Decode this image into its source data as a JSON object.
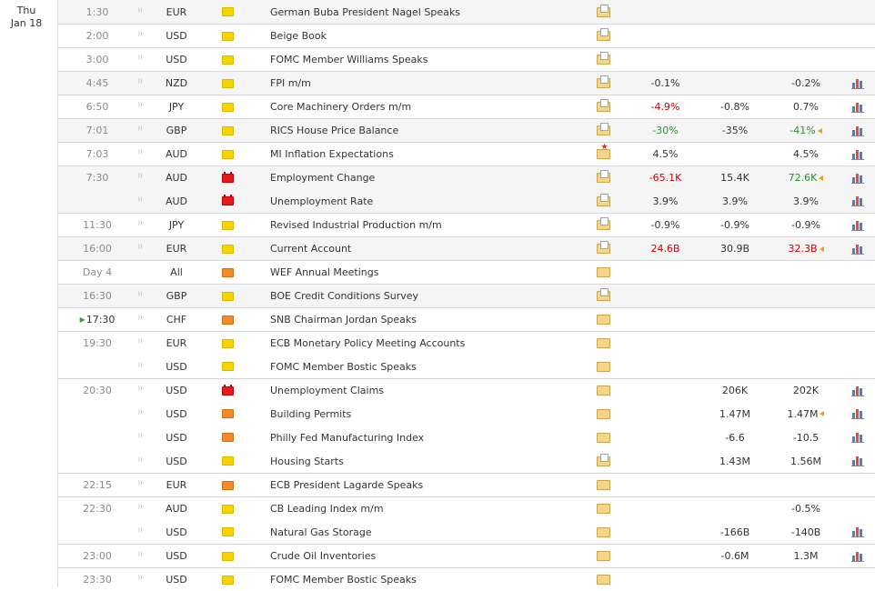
{
  "date": {
    "weekday": "Thu",
    "day": "Jan 18"
  },
  "colors": {
    "negative": "#cc0000",
    "positive": "#2d8e2d",
    "low": "#f6d400",
    "medium": "#f08a2a",
    "high": "#e31d1d"
  },
  "rows": [
    {
      "time": "1:30",
      "cur": "EUR",
      "imp": "low",
      "event": "German Buba President Nagel Speaks",
      "doc": "doc",
      "actual": "",
      "actual_color": "",
      "forecast": "",
      "previous": "",
      "previous_color": "",
      "revised": false,
      "chart": false,
      "alt": true,
      "sep": false
    },
    {
      "time": "2:00",
      "cur": "USD",
      "imp": "low",
      "event": "Beige Book",
      "doc": "doc",
      "actual": "",
      "actual_color": "",
      "forecast": "",
      "previous": "",
      "previous_color": "",
      "revised": false,
      "chart": false,
      "alt": false,
      "sep": true
    },
    {
      "time": "3:00",
      "cur": "USD",
      "imp": "low",
      "event": "FOMC Member Williams Speaks",
      "doc": "doc",
      "actual": "",
      "actual_color": "",
      "forecast": "",
      "previous": "",
      "previous_color": "",
      "revised": false,
      "chart": false,
      "alt": false,
      "sep": true
    },
    {
      "time": "4:45",
      "cur": "NZD",
      "imp": "low",
      "event": "FPI m/m",
      "doc": "doc",
      "actual": "-0.1%",
      "actual_color": "",
      "forecast": "",
      "previous": "-0.2%",
      "previous_color": "",
      "revised": false,
      "chart": true,
      "alt": true,
      "sep": true
    },
    {
      "time": "6:50",
      "cur": "JPY",
      "imp": "low",
      "event": "Core Machinery Orders m/m",
      "doc": "doc",
      "actual": "-4.9%",
      "actual_color": "red",
      "forecast": "-0.8%",
      "previous": "0.7%",
      "previous_color": "",
      "revised": false,
      "chart": true,
      "alt": false,
      "sep": true
    },
    {
      "time": "7:01",
      "cur": "GBP",
      "imp": "low",
      "event": "RICS House Price Balance",
      "doc": "doc",
      "actual": "-30%",
      "actual_color": "green",
      "forecast": "-35%",
      "previous": "-41%",
      "previous_color": "green",
      "revised": true,
      "chart": true,
      "alt": true,
      "sep": true
    },
    {
      "time": "7:03",
      "cur": "AUD",
      "imp": "low",
      "event": "MI Inflation Expectations",
      "doc": "star",
      "actual": "4.5%",
      "actual_color": "",
      "forecast": "",
      "previous": "4.5%",
      "previous_color": "",
      "revised": false,
      "chart": true,
      "alt": false,
      "sep": true
    },
    {
      "time": "7:30",
      "cur": "AUD",
      "imp": "high",
      "event": "Employment Change",
      "doc": "doc",
      "actual": "-65.1K",
      "actual_color": "red",
      "forecast": "15.4K",
      "previous": "72.6K",
      "previous_color": "green",
      "revised": true,
      "chart": true,
      "alt": true,
      "sep": true
    },
    {
      "time": "",
      "cur": "AUD",
      "imp": "high",
      "event": "Unemployment Rate",
      "doc": "doc",
      "actual": "3.9%",
      "actual_color": "",
      "forecast": "3.9%",
      "previous": "3.9%",
      "previous_color": "",
      "revised": false,
      "chart": true,
      "alt": true,
      "sep": false
    },
    {
      "time": "11:30",
      "cur": "JPY",
      "imp": "low",
      "event": "Revised Industrial Production m/m",
      "doc": "doc",
      "actual": "-0.9%",
      "actual_color": "",
      "forecast": "-0.9%",
      "previous": "-0.9%",
      "previous_color": "",
      "revised": false,
      "chart": true,
      "alt": false,
      "sep": true
    },
    {
      "time": "16:00",
      "cur": "EUR",
      "imp": "low",
      "event": "Current Account",
      "doc": "doc",
      "actual": "24.6B",
      "actual_color": "red",
      "forecast": "30.9B",
      "previous": "32.3B",
      "previous_color": "red",
      "revised": true,
      "chart": true,
      "alt": true,
      "sep": true
    },
    {
      "time": "Day 4",
      "cur": "All",
      "imp": "med",
      "event": "WEF Annual Meetings",
      "doc": "plain",
      "actual": "",
      "actual_color": "",
      "forecast": "",
      "previous": "",
      "previous_color": "",
      "revised": false,
      "chart": false,
      "alt": false,
      "sep": true
    },
    {
      "time": "16:30",
      "cur": "GBP",
      "imp": "low",
      "event": "BOE Credit Conditions Survey",
      "doc": "doc",
      "actual": "",
      "actual_color": "",
      "forecast": "",
      "previous": "",
      "previous_color": "",
      "revised": false,
      "chart": false,
      "alt": true,
      "sep": true
    },
    {
      "time": "17:30",
      "cur": "CHF",
      "imp": "med",
      "event": "SNB Chairman Jordan Speaks",
      "doc": "plain",
      "actual": "",
      "actual_color": "",
      "forecast": "",
      "previous": "",
      "previous_color": "",
      "revised": false,
      "chart": false,
      "alt": false,
      "sep": true,
      "live": true
    },
    {
      "time": "19:30",
      "cur": "EUR",
      "imp": "low",
      "event": "ECB Monetary Policy Meeting Accounts",
      "doc": "plain",
      "actual": "",
      "actual_color": "",
      "forecast": "",
      "previous": "",
      "previous_color": "",
      "revised": false,
      "chart": false,
      "alt": false,
      "sep": true
    },
    {
      "time": "",
      "cur": "USD",
      "imp": "low",
      "event": "FOMC Member Bostic Speaks",
      "doc": "plain",
      "actual": "",
      "actual_color": "",
      "forecast": "",
      "previous": "",
      "previous_color": "",
      "revised": false,
      "chart": false,
      "alt": false,
      "sep": false
    },
    {
      "time": "20:30",
      "cur": "USD",
      "imp": "high",
      "event": "Unemployment Claims",
      "doc": "plain",
      "actual": "",
      "actual_color": "",
      "forecast": "206K",
      "previous": "202K",
      "previous_color": "",
      "revised": false,
      "chart": true,
      "alt": false,
      "sep": true
    },
    {
      "time": "",
      "cur": "USD",
      "imp": "med",
      "event": "Building Permits",
      "doc": "plain",
      "actual": "",
      "actual_color": "",
      "forecast": "1.47M",
      "previous": "1.47M",
      "previous_color": "",
      "revised": true,
      "chart": true,
      "alt": false,
      "sep": false
    },
    {
      "time": "",
      "cur": "USD",
      "imp": "med",
      "event": "Philly Fed Manufacturing Index",
      "doc": "plain",
      "actual": "",
      "actual_color": "",
      "forecast": "-6.6",
      "previous": "-10.5",
      "previous_color": "",
      "revised": false,
      "chart": true,
      "alt": false,
      "sep": false
    },
    {
      "time": "",
      "cur": "USD",
      "imp": "low",
      "event": "Housing Starts",
      "doc": "doc",
      "actual": "",
      "actual_color": "",
      "forecast": "1.43M",
      "previous": "1.56M",
      "previous_color": "",
      "revised": false,
      "chart": true,
      "alt": false,
      "sep": false
    },
    {
      "time": "22:15",
      "cur": "EUR",
      "imp": "med",
      "event": "ECB President Lagarde Speaks",
      "doc": "plain",
      "actual": "",
      "actual_color": "",
      "forecast": "",
      "previous": "",
      "previous_color": "",
      "revised": false,
      "chart": false,
      "alt": false,
      "sep": true
    },
    {
      "time": "22:30",
      "cur": "AUD",
      "imp": "low",
      "event": "CB Leading Index m/m",
      "doc": "plain",
      "actual": "",
      "actual_color": "",
      "forecast": "",
      "previous": "-0.5%",
      "previous_color": "",
      "revised": false,
      "chart": false,
      "alt": false,
      "sep": true
    },
    {
      "time": "",
      "cur": "USD",
      "imp": "low",
      "event": "Natural Gas Storage",
      "doc": "plain",
      "actual": "",
      "actual_color": "",
      "forecast": "-166B",
      "previous": "-140B",
      "previous_color": "",
      "revised": false,
      "chart": true,
      "alt": false,
      "sep": false
    },
    {
      "time": "23:00",
      "cur": "USD",
      "imp": "low",
      "event": "Crude Oil Inventories",
      "doc": "plain",
      "actual": "",
      "actual_color": "",
      "forecast": "-0.6M",
      "previous": "1.3M",
      "previous_color": "",
      "revised": false,
      "chart": true,
      "alt": false,
      "sep": true
    },
    {
      "time": "23:30",
      "cur": "USD",
      "imp": "low",
      "event": "FOMC Member Bostic Speaks",
      "doc": "plain",
      "actual": "",
      "actual_color": "",
      "forecast": "",
      "previous": "",
      "previous_color": "",
      "revised": false,
      "chart": false,
      "alt": false,
      "sep": true
    }
  ]
}
